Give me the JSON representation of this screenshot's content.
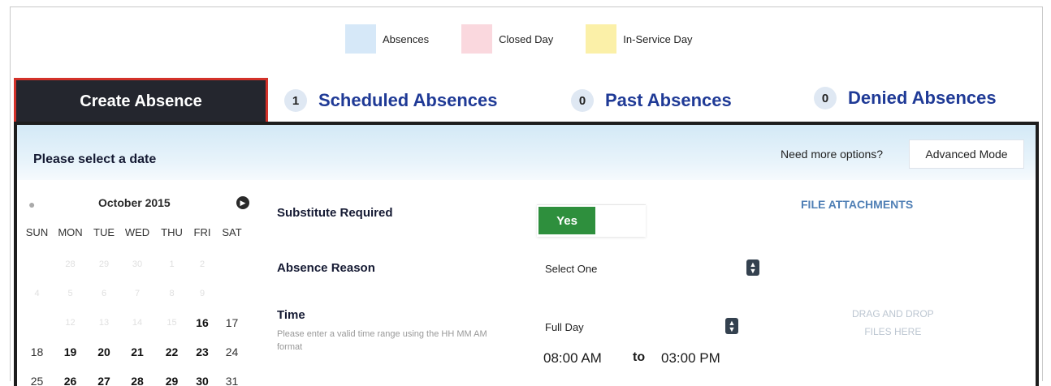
{
  "legend": {
    "items": [
      {
        "label": "Absences",
        "color": "#d6e8f8"
      },
      {
        "label": "Closed Day",
        "color": "#fad8de"
      },
      {
        "label": "In-Service Day",
        "color": "#fbf0a8"
      }
    ]
  },
  "tabs": {
    "active": {
      "label": "Create Absence"
    },
    "scheduled": {
      "count": "1",
      "label": "Scheduled Absences"
    },
    "past": {
      "count": "0",
      "label": "Past Absences"
    },
    "denied": {
      "count": "0",
      "label": "Denied Absences"
    }
  },
  "banner": {
    "title": "Please select a date",
    "more_options": "Need more options?",
    "advanced_button": "Advanced Mode"
  },
  "calendar": {
    "month": "October 2015",
    "prev_icon": "chevron-left-icon",
    "next_icon": "chevron-right-icon",
    "days_of_week": [
      "SUN",
      "MON",
      "TUE",
      "WED",
      "THU",
      "FRI",
      "SAT"
    ],
    "weeks": [
      [
        {
          "d": "",
          "s": "n"
        },
        {
          "d": "28",
          "s": "f"
        },
        {
          "d": "29",
          "s": "f"
        },
        {
          "d": "30",
          "s": "f"
        },
        {
          "d": "1",
          "s": "f"
        },
        {
          "d": "2",
          "s": "f"
        },
        {
          "d": "",
          "s": "n"
        }
      ],
      [
        {
          "d": "4",
          "s": "f"
        },
        {
          "d": "5",
          "s": "f"
        },
        {
          "d": "6",
          "s": "f"
        },
        {
          "d": "7",
          "s": "f"
        },
        {
          "d": "8",
          "s": "f"
        },
        {
          "d": "9",
          "s": "f"
        },
        {
          "d": "",
          "s": "n"
        }
      ],
      [
        {
          "d": "",
          "s": "n"
        },
        {
          "d": "12",
          "s": "f"
        },
        {
          "d": "13",
          "s": "f"
        },
        {
          "d": "14",
          "s": "f"
        },
        {
          "d": "15",
          "s": "f"
        },
        {
          "d": "16",
          "s": "b"
        },
        {
          "d": "17",
          "s": "n"
        }
      ],
      [
        {
          "d": "18",
          "s": "n"
        },
        {
          "d": "19",
          "s": "b"
        },
        {
          "d": "20",
          "s": "b"
        },
        {
          "d": "21",
          "s": "b"
        },
        {
          "d": "22",
          "s": "b"
        },
        {
          "d": "23",
          "s": "b"
        },
        {
          "d": "24",
          "s": "n"
        }
      ],
      [
        {
          "d": "25",
          "s": "n"
        },
        {
          "d": "26",
          "s": "b"
        },
        {
          "d": "27",
          "s": "b"
        },
        {
          "d": "28",
          "s": "b"
        },
        {
          "d": "29",
          "s": "b"
        },
        {
          "d": "30",
          "s": "b"
        },
        {
          "d": "31",
          "s": "n"
        }
      ]
    ]
  },
  "form": {
    "substitute_label": "Substitute Required",
    "substitute_value": "Yes",
    "reason_label": "Absence Reason",
    "reason_value": "Select One",
    "time_label": "Time",
    "time_hint": "Please enter a valid time range using the HH MM AM format",
    "duration_value": "Full Day",
    "start_time": "08:00 AM",
    "to_label": "to",
    "end_time": "03:00 PM"
  },
  "attachments": {
    "title": "FILE ATTACHMENTS",
    "drop_line1": "DRAG AND DROP",
    "drop_line2": "FILES HERE"
  }
}
